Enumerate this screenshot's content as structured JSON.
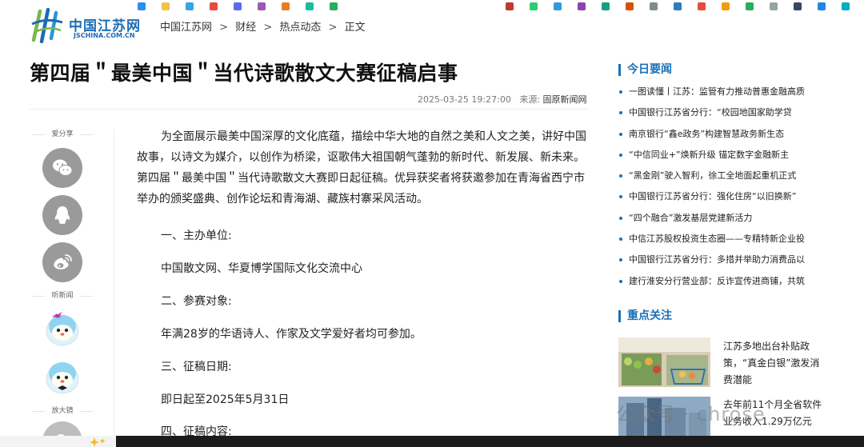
{
  "header": {
    "logo_cn": "中国江苏网",
    "logo_en": "JSCHINA.COM.CN",
    "breadcrumb": [
      "中国江苏网",
      "财经",
      "热点动态",
      "正文"
    ],
    "breadcrumb_sep": ">"
  },
  "article": {
    "title": "第四届＂最美中国＂当代诗歌散文大赛征稿启事",
    "datetime": "2025-03-25 19:27:00",
    "source_label": "来源:",
    "source": "固原新闻网",
    "intro": "为全面展示最美中国深厚的文化底蕴，描绘中华大地的自然之美和人文之美，讲好中国故事，以诗文为媒介，以创作为桥梁，讴歌伟大祖国朝气蓬勃的新时代、新发展、新未来。第四届＂最美中国＂当代诗歌散文大赛即日起征稿。优异获奖者将获邀参加在青海省西宁市举办的颁奖盛典、创作论坛和青海湖、藏族村寨采风活动。",
    "h1": "一、主办单位:",
    "p1": "中国散文网、华夏博学国际文化交流中心",
    "h2": "二、参赛对象:",
    "p2": "年满28岁的华语诗人、作家及文学爱好者均可参加。",
    "h3": "三、征稿日期:",
    "p3": "即日起至2025年5月31日",
    "h4": "四、征稿内容:"
  },
  "share": {
    "share_label": "爱分享",
    "listen_label": "听新闻",
    "zoom_label": "放大镜",
    "icons": [
      "wechat-icon",
      "qq-icon",
      "weibo-icon"
    ]
  },
  "sidebar": {
    "today_title": "今日要闻",
    "today_items": [
      "一图读懂丨江苏：监管有力推动普惠金融高质",
      "中国银行江苏省分行：“校园地国家助学贷",
      "南京银行“鑫e政务”构建智慧政务新生态",
      "“中信同业+”焕新升级 锚定数字金融新主",
      "“黑金刚”驶入智利，徐工全地面起重机正式",
      "中国银行江苏省分行：强化住房“以旧换新”",
      "“四个融合”激发基层党建新活力",
      "中信江苏股权投资生态圈——专精特新企业投",
      "中国银行江苏省分行：多措并举助力消费品以",
      "建行淮安分行营业部：反诈宣传进商铺，共筑"
    ],
    "focus_title": "重点关注",
    "focus_items": [
      "江苏多地出台补贴政策，“真金白银”激发消费潜能",
      "去年前11个月全省软件业务收入1.29万亿元"
    ]
  },
  "watermark": "公众号 · chrose",
  "colors": {
    "accent": "#1a70b8",
    "share_gray": "#9a9a9a"
  }
}
